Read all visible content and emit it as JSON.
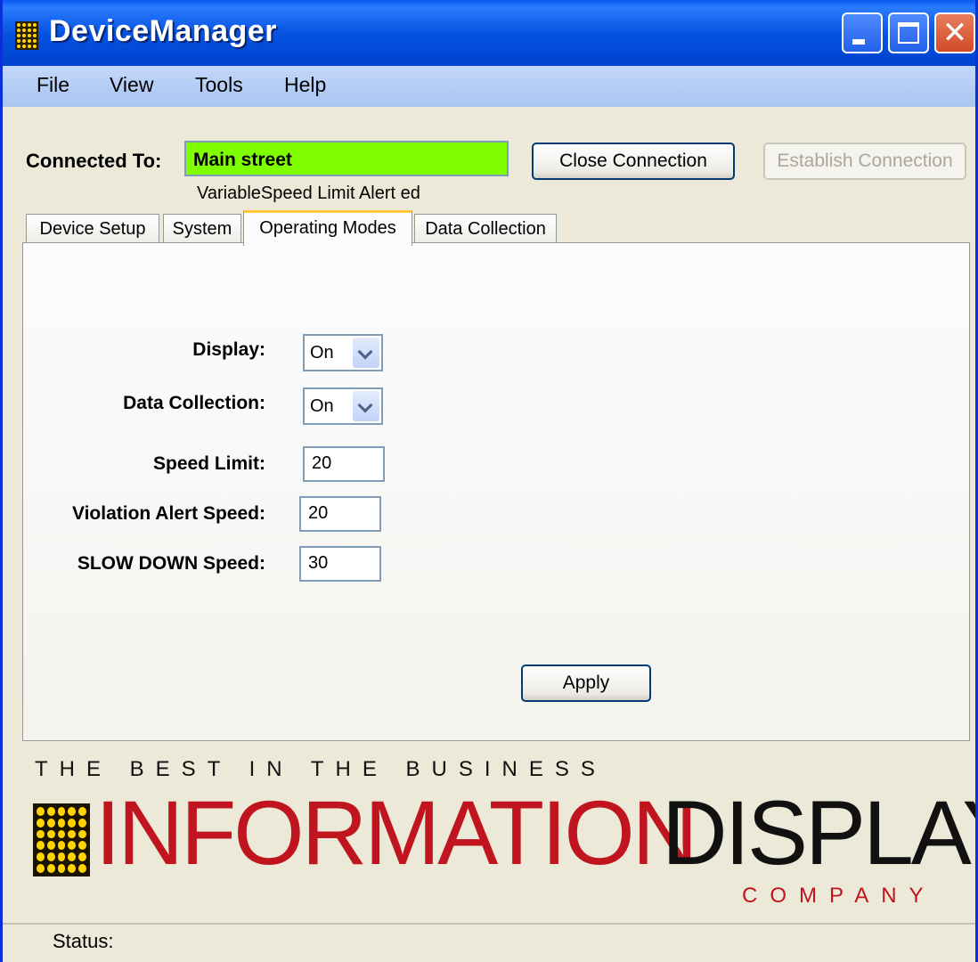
{
  "window": {
    "title": "DeviceManager",
    "close_glyph": "✕"
  },
  "menu": [
    "File",
    "View",
    "Tools",
    "Help"
  ],
  "connection": {
    "label": "Connected To:",
    "value": "Main street",
    "value_bg": "#80FF00",
    "close_button": "Close Connection",
    "establish_button": "Establish Connection",
    "establish_enabled": false,
    "alert_text": "VariableSpeed Limit Alert ed"
  },
  "tabs": [
    "Device Setup",
    "System",
    "Operating Modes",
    "Data Collection"
  ],
  "active_tab": "Operating Modes",
  "form": {
    "display_label": "Display:",
    "display_value": "On",
    "data_collection_label": "Data Collection:",
    "data_collection_value": "On",
    "speed_limit_label": "Speed Limit:",
    "speed_limit_value": "20",
    "violation_label": "Violation Alert Speed:",
    "violation_value": "20",
    "slowdown_label": "SLOW DOWN Speed:",
    "slowdown_value": "30",
    "apply_button": "Apply"
  },
  "branding": {
    "slogan": "THE BEST IN THE BUSINESS",
    "name_red": "INFORMATION",
    "name_black": "DISPLAY",
    "company": "COMPANY",
    "accent_red": "#C0141E"
  },
  "status": {
    "label": "Status:"
  }
}
